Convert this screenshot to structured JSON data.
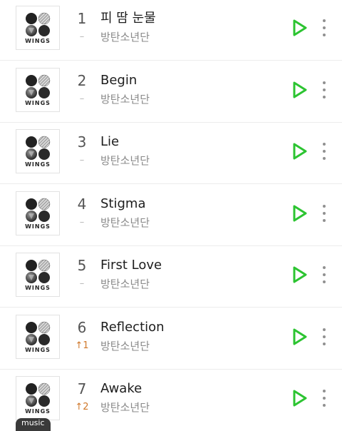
{
  "colors": {
    "play_accent": "#2cc431",
    "rank_up": "#d0782b",
    "rank_same": "#b7b7b7"
  },
  "album_label": "WINGS",
  "rows": [
    {
      "rank": "1",
      "change": "–",
      "change_dir": "same",
      "title": "피 땀 눈물",
      "artist": "방탄소년단"
    },
    {
      "rank": "2",
      "change": "–",
      "change_dir": "same",
      "title": "Begin",
      "artist": "방탄소년단"
    },
    {
      "rank": "3",
      "change": "–",
      "change_dir": "same",
      "title": "Lie",
      "artist": "방탄소년단"
    },
    {
      "rank": "4",
      "change": "–",
      "change_dir": "same",
      "title": "Stigma",
      "artist": "방탄소년단"
    },
    {
      "rank": "5",
      "change": "–",
      "change_dir": "same",
      "title": "First Love",
      "artist": "방탄소년단"
    },
    {
      "rank": "6",
      "change": "↑1",
      "change_dir": "up",
      "title": "Reflection",
      "artist": "방탄소년단"
    },
    {
      "rank": "7",
      "change": "↑2",
      "change_dir": "up",
      "title": "Awake",
      "artist": "방탄소년단"
    }
  ],
  "brand_badge": "music",
  "icons": {
    "play": "play-icon",
    "more": "more-vertical-icon",
    "cover": "album-cover-wings"
  }
}
